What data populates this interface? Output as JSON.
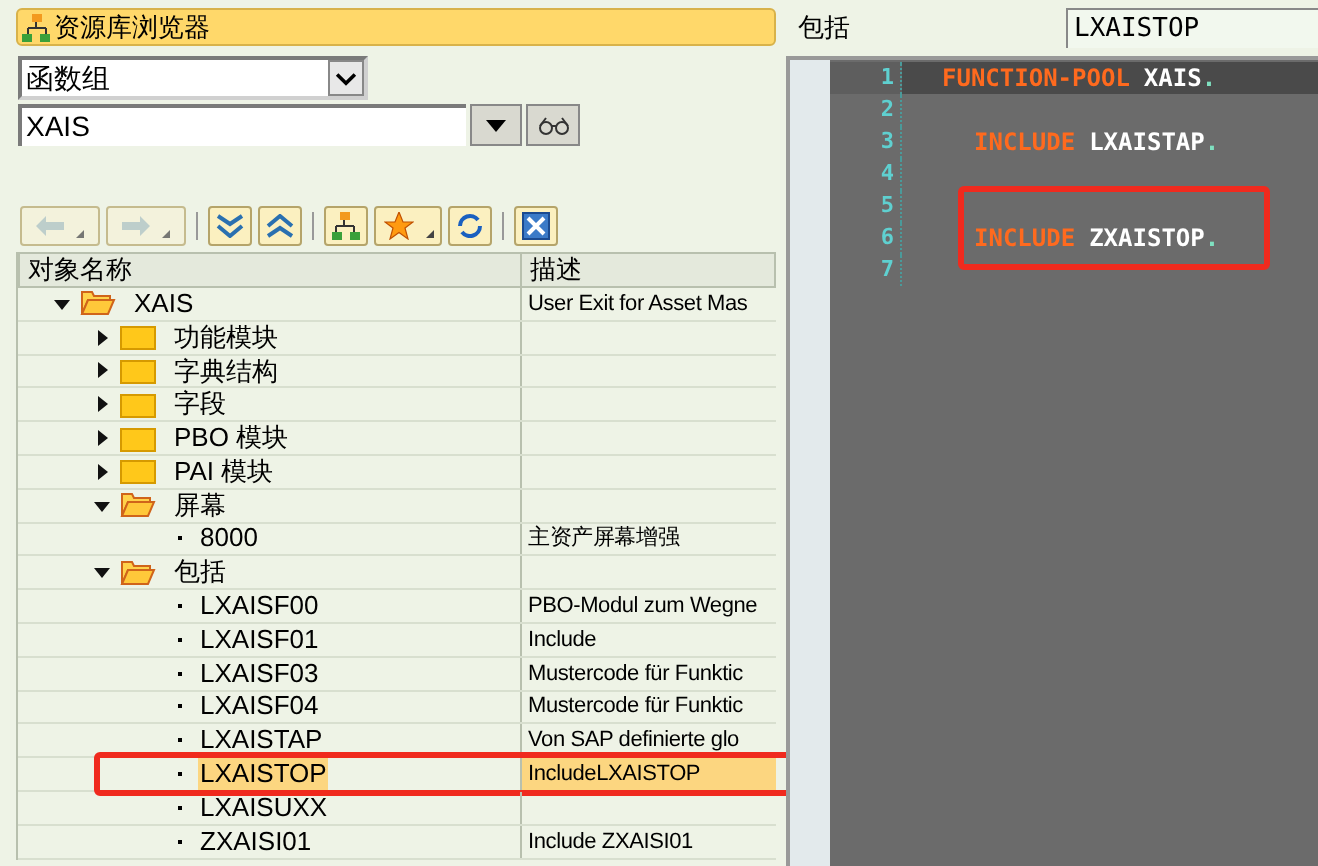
{
  "browser": {
    "title": "资源库浏览器",
    "object_type": "函数组",
    "object_name": "XAIS"
  },
  "tree": {
    "columns": [
      "对象名称",
      "描述"
    ],
    "nodes": [
      {
        "name": "XAIS",
        "description": "User Exit for Asset Mas",
        "kind": "folder",
        "expanded": true,
        "selected": false,
        "annotated": false,
        "children": [
          {
            "name": "功能模块",
            "kind": "folder",
            "expanded": false,
            "selected": false,
            "annotated": false
          },
          {
            "name": "字典结构",
            "kind": "folder",
            "expanded": false,
            "selected": false,
            "annotated": false
          },
          {
            "name": "字段",
            "kind": "folder",
            "expanded": false,
            "selected": false,
            "annotated": false
          },
          {
            "name": "PBO 模块",
            "kind": "folder",
            "expanded": false,
            "selected": false,
            "annotated": false
          },
          {
            "name": "PAI 模块",
            "kind": "folder",
            "expanded": false,
            "selected": false,
            "annotated": false
          },
          {
            "name": "屏幕",
            "kind": "folder",
            "expanded": true,
            "selected": false,
            "annotated": false,
            "children": [
              {
                "name": "8000",
                "description": "主资产屏幕增强",
                "kind": "leaf",
                "selected": false,
                "annotated": false
              }
            ]
          },
          {
            "name": "包括",
            "kind": "folder",
            "expanded": true,
            "selected": false,
            "annotated": false,
            "children": [
              {
                "name": "LXAISF00",
                "description": "PBO-Modul zum Wegne",
                "kind": "leaf",
                "selected": false,
                "annotated": false
              },
              {
                "name": "LXAISF01",
                "description": "Include",
                "kind": "leaf",
                "selected": false,
                "annotated": false
              },
              {
                "name": "LXAISF03",
                "description": "Mustercode für Funktic",
                "kind": "leaf",
                "selected": false,
                "annotated": false
              },
              {
                "name": "LXAISF04",
                "description": "Mustercode für Funktic",
                "kind": "leaf",
                "selected": false,
                "annotated": false
              },
              {
                "name": "LXAISTAP",
                "description": "Von SAP definierte glo",
                "kind": "leaf",
                "selected": false,
                "annotated": false
              },
              {
                "name": "LXAISTOP",
                "description": "IncludeLXAISTOP",
                "kind": "leaf",
                "selected": true,
                "annotated": true
              },
              {
                "name": "LXAISUXX",
                "kind": "leaf",
                "selected": false,
                "annotated": false
              },
              {
                "name": "ZXAISI01",
                "description": "Include ZXAISI01",
                "kind": "leaf",
                "selected": false,
                "annotated": false
              }
            ]
          }
        ]
      }
    ]
  },
  "editor": {
    "label": "包括",
    "program": "LXAISTOP",
    "lines": [
      {
        "number": "1",
        "current": true,
        "annotated": false,
        "indented": false,
        "tokens": [
          {
            "text": "FUNCTION-POOL",
            "kind": "keyword"
          },
          {
            "text": "XAIS",
            "kind": "name"
          },
          {
            "text": ".",
            "kind": "punct"
          }
        ]
      },
      {
        "number": "2",
        "current": false,
        "annotated": false
      },
      {
        "number": "3",
        "current": false,
        "annotated": false,
        "indented": true,
        "tokens": [
          {
            "text": "INCLUDE",
            "kind": "keyword"
          },
          {
            "text": "LXAISTAP",
            "kind": "name"
          },
          {
            "text": ".",
            "kind": "punct"
          }
        ]
      },
      {
        "number": "4",
        "current": false,
        "annotated": false
      },
      {
        "number": "5",
        "current": false,
        "annotated": false
      },
      {
        "number": "6",
        "current": false,
        "annotated": true,
        "indented": true,
        "tokens": [
          {
            "text": "INCLUDE",
            "kind": "keyword"
          },
          {
            "text": "ZXAISTOP",
            "kind": "name"
          },
          {
            "text": ".",
            "kind": "punct"
          }
        ]
      },
      {
        "number": "7",
        "current": false,
        "annotated": false
      }
    ]
  }
}
